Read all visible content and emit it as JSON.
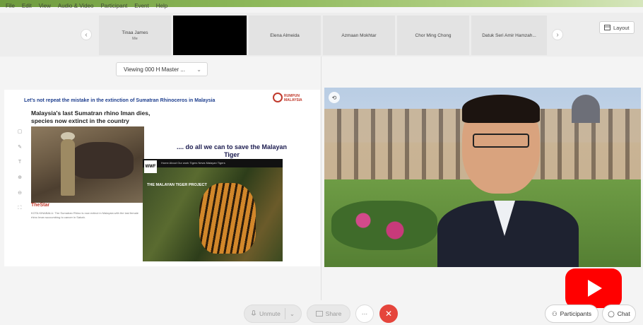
{
  "menu": [
    "File",
    "Edit",
    "View",
    "Audio & Video",
    "Participant",
    "Event",
    "Help"
  ],
  "participants": [
    {
      "name": "Tinaa James",
      "sub": "Me"
    },
    {
      "name": "",
      "sub": ""
    },
    {
      "name": "Elena Almeida",
      "sub": ""
    },
    {
      "name": "Azmaan Mokhtar",
      "sub": ""
    },
    {
      "name": "Chor Ming Chong",
      "sub": ""
    },
    {
      "name": "Datuk Seri Amir Hamzah...",
      "sub": ""
    }
  ],
  "strip_nav": {
    "prev": "‹",
    "next": "›"
  },
  "layout_button": {
    "label": "Layout",
    "icon": "layout-icon"
  },
  "viewing": {
    "label": "Viewing 000 H Master ..."
  },
  "slide": {
    "title": "Let's not repeat the mistake in the extinction of Sumatran Rhinoceros in Malaysia",
    "logo_text": "RUMPUN MALAYSIA",
    "headline": "Malaysia's last Sumatran rhino Iman dies, species now extinct in the country",
    "source": "TheStar",
    "caption": "KOTA KINABALU: The Sumatran Rhino is now extinct in Malaysia with the last female rhino Iman succumbing to cancer in Sabah.",
    "tiger_title": ".... do all we can to save the Malayan Tiger",
    "wwf_label": "WWF",
    "wwf_nav": "Home  About  Our work  Tigers  News  Malayan Tigers",
    "wwf_headline": "THE MALAYAN TIGER PROJECT"
  },
  "controls": {
    "unmute": "Unmute",
    "share": "Share",
    "more": "···",
    "end": "✕",
    "participants": "Participants",
    "chat": "Chat"
  }
}
